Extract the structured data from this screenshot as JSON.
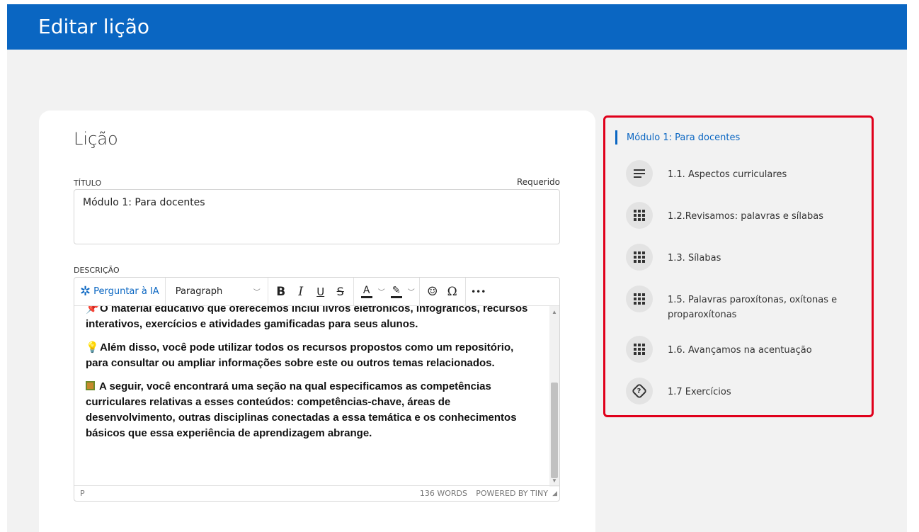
{
  "header": {
    "title": "Editar lição"
  },
  "lesson": {
    "heading": "Lição",
    "title_field": {
      "label": "TÍTULO",
      "required_text": "Requerido",
      "value": "Módulo 1: Para docentes"
    },
    "description_field": {
      "label": "DESCRIÇÃO"
    }
  },
  "editor": {
    "toolbar": {
      "ai_label": "Perguntar à IA",
      "block_format": "Paragraph",
      "bold": "B",
      "italic": "I",
      "underline": "U",
      "strike": "S",
      "text_color": "A",
      "emoji": "☺",
      "special_char": "Ω",
      "more": "•••"
    },
    "paragraphs": [
      {
        "emoji": "pin",
        "text": "O material educativo que oferecemos inclui livros eletrônicos, infográficos, recursos interativos, exercícios e atividades gamificadas para seus alunos."
      },
      {
        "emoji": "bulb",
        "text": "Além disso, você pode utilizar todos os recursos propostos como um repositório, para consultar ou ampliar informações sobre este ou outros temas relacionados."
      },
      {
        "emoji": "gift",
        "text": "A seguir, você encontrará uma seção na qual especificamos as competências curriculares relativas a esses conteúdos: competências-chave, áreas de desenvolvimento, outras disciplinas conectadas a essa temática e os conhecimentos básicos que essa experiência de aprendizagem abrange."
      }
    ],
    "status": {
      "path": "P",
      "word_count": "136 WORDS",
      "powered_by": "POWERED BY TINY"
    }
  },
  "sidebar": {
    "module_title": "Módulo 1: Para docentes",
    "items": [
      {
        "icon": "lines-icon",
        "label": "1.1. Aspectos curriculares"
      },
      {
        "icon": "grid-icon",
        "label": "1.2.Revisamos: palavras e sílabas"
      },
      {
        "icon": "grid-icon",
        "label": "1.3. Sílabas"
      },
      {
        "icon": "grid-icon",
        "label": "1.5. Palavras paroxítonas, oxítonas e proparoxítonas"
      },
      {
        "icon": "grid-icon",
        "label": "1.6. Avançamos na acentuação"
      },
      {
        "icon": "quiz-icon",
        "label": "1.7 Exercícios"
      }
    ]
  },
  "colors": {
    "header_bg": "#0a66c2",
    "accent": "#0a66c2",
    "highlight_border": "#e0001b"
  }
}
